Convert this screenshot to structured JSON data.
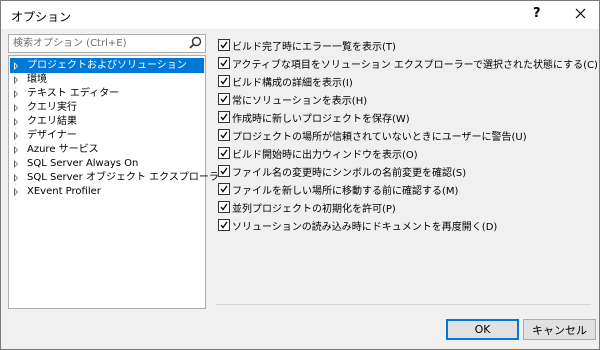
{
  "window": {
    "title": "オプション",
    "help_label": "?"
  },
  "search": {
    "placeholder": "検索オプション (Ctrl+E)"
  },
  "tree": {
    "items": [
      {
        "label": "プロジェクトおよびソリューション",
        "selected": true
      },
      {
        "label": "環境"
      },
      {
        "label": "テキスト エディター"
      },
      {
        "label": "クエリ実行"
      },
      {
        "label": "クエリ結果"
      },
      {
        "label": "デザイナー"
      },
      {
        "label": "Azure サービス"
      },
      {
        "label": "SQL Server Always On"
      },
      {
        "label": "SQL Server オブジェクト エクスプローラー"
      },
      {
        "label": "XEvent Profiler"
      }
    ]
  },
  "options": [
    {
      "label": "ビルド完了時にエラー一覧を表示(T)",
      "checked": true
    },
    {
      "label": "アクティブな項目をソリューション エクスプローラーで選択された状態にする(C)",
      "checked": true
    },
    {
      "label": "ビルド構成の詳細を表示(I)",
      "checked": true
    },
    {
      "label": "常にソリューションを表示(H)",
      "checked": true
    },
    {
      "label": "作成時に新しいプロジェクトを保存(W)",
      "checked": true
    },
    {
      "label": "プロジェクトの場所が信頼されていないときにユーザーに警告(U)",
      "checked": true
    },
    {
      "label": "ビルド開始時に出力ウィンドウを表示(O)",
      "checked": true
    },
    {
      "label": "ファイル名の変更時にシンボルの名前変更を確認(S)",
      "checked": true
    },
    {
      "label": "ファイルを新しい場所に移動する前に確認する(M)",
      "checked": true
    },
    {
      "label": "並列プロジェクトの初期化を許可(P)",
      "checked": true
    },
    {
      "label": "ソリューションの読み込み時にドキュメントを再度開く(D)",
      "checked": true
    }
  ],
  "buttons": {
    "ok": "OK",
    "cancel": "キャンセル"
  },
  "colors": {
    "accent": "#0078d7",
    "background": "#f0f0f0"
  }
}
